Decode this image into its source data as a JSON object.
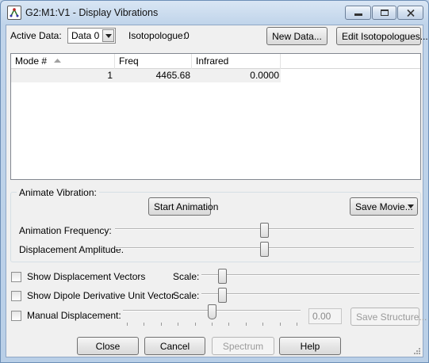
{
  "window": {
    "title": "G2:M1:V1 - Display Vibrations",
    "minimize_glyph": "minimize-icon",
    "maximize_glyph": "maximize-icon",
    "close_glyph": "close-icon"
  },
  "top": {
    "active_data_label": "Active Data:",
    "active_data_value": "Data 0",
    "isotopologue_label": "Isotopologue:",
    "isotopologue_value": "0",
    "new_data_button": "New Data...",
    "edit_isotopologues_button": "Edit Isotopologues..."
  },
  "table": {
    "columns": [
      "Mode #",
      "Freq",
      "Infrared"
    ],
    "sort_column": "Mode #",
    "rows": [
      {
        "mode": "1",
        "freq": "4465.68",
        "infrared": "0.0000"
      }
    ]
  },
  "animate": {
    "group_label": "Animate Vibration:",
    "start_button": "Start Animation",
    "save_movie_button": "Save Movie...",
    "frequency_label": "Animation Frequency:",
    "frequency_level": 0.5,
    "amplitude_label": "Displacement Amplitude:",
    "amplitude_level": 0.5
  },
  "options": {
    "show_vectors_label": "Show Displacement Vectors",
    "show_vectors_checked": false,
    "vectors_scale_label": "Scale:",
    "vectors_scale_level": 0.08,
    "show_dipole_label": "Show Dipole Derivative Unit Vector",
    "show_dipole_checked": false,
    "dipole_scale_label": "Scale:",
    "dipole_scale_level": 0.08,
    "manual_label": "Manual Displacement:",
    "manual_checked": false,
    "manual_level": 0.5,
    "manual_value": "0.00",
    "save_structure_button": "Save Structure..."
  },
  "footer": {
    "close_button": "Close",
    "cancel_button": "Cancel",
    "spectrum_button": "Spectrum",
    "help_button": "Help"
  }
}
